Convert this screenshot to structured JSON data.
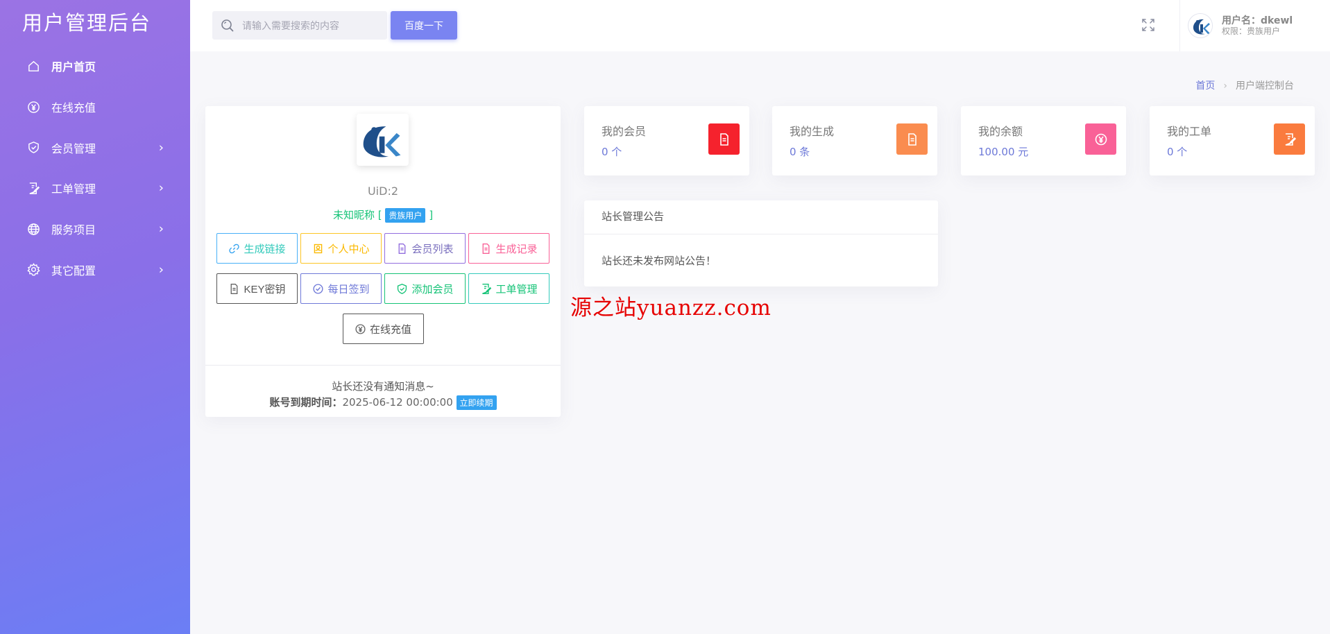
{
  "sidebar": {
    "title": "用户管理后台",
    "items": [
      {
        "label": "用户首页",
        "icon": "home-icon",
        "active": true,
        "has_arrow": false
      },
      {
        "label": "在线充值",
        "icon": "yen-icon",
        "active": false,
        "has_arrow": false
      },
      {
        "label": "会员管理",
        "icon": "shield-icon",
        "active": false,
        "has_arrow": true
      },
      {
        "label": "工单管理",
        "icon": "ticket-icon",
        "active": false,
        "has_arrow": true
      },
      {
        "label": "服务项目",
        "icon": "globe-icon",
        "active": false,
        "has_arrow": true
      },
      {
        "label": "其它配置",
        "icon": "gear-icon",
        "active": false,
        "has_arrow": true
      }
    ]
  },
  "header": {
    "search_placeholder": "请输入需要搜索的内容",
    "search_button": "百度一下",
    "user_name": "用户名：dkewl",
    "user_role": "权限：贵族用户"
  },
  "breadcrumb": {
    "home": "首页",
    "current": "用户端控制台"
  },
  "profile": {
    "uid": "UiD:2",
    "nickname": "未知昵称",
    "bracket_open": "[",
    "bracket_close": "]",
    "role_tag": "贵族用户",
    "buttons_row1": [
      {
        "label": "生成链接",
        "icon": "link-icon"
      },
      {
        "label": "个人中心",
        "icon": "user-icon"
      },
      {
        "label": "会员列表",
        "icon": "document-icon"
      },
      {
        "label": "生成记录",
        "icon": "document-icon"
      }
    ],
    "buttons_row2": [
      {
        "label": "KEY密钥",
        "icon": "document-icon"
      },
      {
        "label": "每日签到",
        "icon": "check-circle-icon"
      },
      {
        "label": "添加会员",
        "icon": "shield-check-icon"
      },
      {
        "label": "工单管理",
        "icon": "ticket-icon"
      }
    ],
    "buttons_row3": [
      {
        "label": "在线充值",
        "icon": "yen-icon"
      }
    ],
    "notice": "站长还没有通知消息~",
    "expiry_label": "账号到期时间：",
    "expiry_value": "2025-06-12 00:00:00",
    "renew_button": "立即续期"
  },
  "stats": [
    {
      "label": "我的会员",
      "value": "0 个",
      "color": "#f5222d",
      "icon": "document-icon"
    },
    {
      "label": "我的生成",
      "value": "0 条",
      "color": "#fa8c4f",
      "icon": "document-icon"
    },
    {
      "label": "我的余额",
      "value": "100.00 元",
      "color": "#f96197",
      "icon": "yen-icon"
    },
    {
      "label": "我的工单",
      "value": "0 个",
      "color": "#fa7b3e",
      "icon": "ticket-icon"
    }
  ],
  "announcement": {
    "title": "站长管理公告",
    "body": "站长还未发布网站公告！"
  },
  "watermark": "源之站yuanzz.com"
}
